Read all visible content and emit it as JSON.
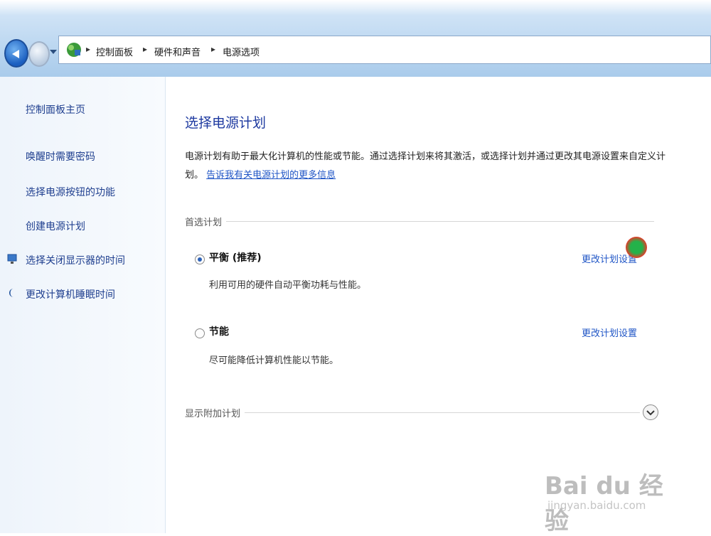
{
  "address_bar": {
    "crumbs": [
      "控制面板",
      "硬件和声音",
      "电源选项"
    ]
  },
  "left_nav": {
    "home_link": "控制面板主页",
    "links": [
      "唤醒时需要密码",
      "选择电源按钮的功能",
      "创建电源计划",
      "选择关闭显示器的时间",
      "更改计算机睡眠时间"
    ]
  },
  "main": {
    "title": "选择电源计划",
    "description": "电源计划有助于最大化计算机的性能或节能。通过选择计划来将其激活，或选择计划并通过更改其电源设置来自定义计划。",
    "description_link": "告诉我有关电源计划的更多信息",
    "section_preferred": "首选计划",
    "plans": [
      {
        "name": "平衡 (推荐)",
        "description": "利用可用的硬件自动平衡功耗与性能。",
        "link": "更改计划设置",
        "selected": true
      },
      {
        "name": "节能",
        "description": "尽可能降低计算机性能以节能。",
        "link": "更改计划设置",
        "selected": false
      }
    ],
    "section_more": "显示附加计划"
  },
  "watermark": {
    "brand": "Bai du 经验",
    "url": "jingyan.baidu.com"
  },
  "icons": {
    "back": "back-arrow-icon",
    "forward": "forward-arrow-icon",
    "control_panel": "control-panel-icon",
    "monitor": "monitor-icon",
    "moon": "moon-icon",
    "expand": "chevron-down-icon"
  }
}
